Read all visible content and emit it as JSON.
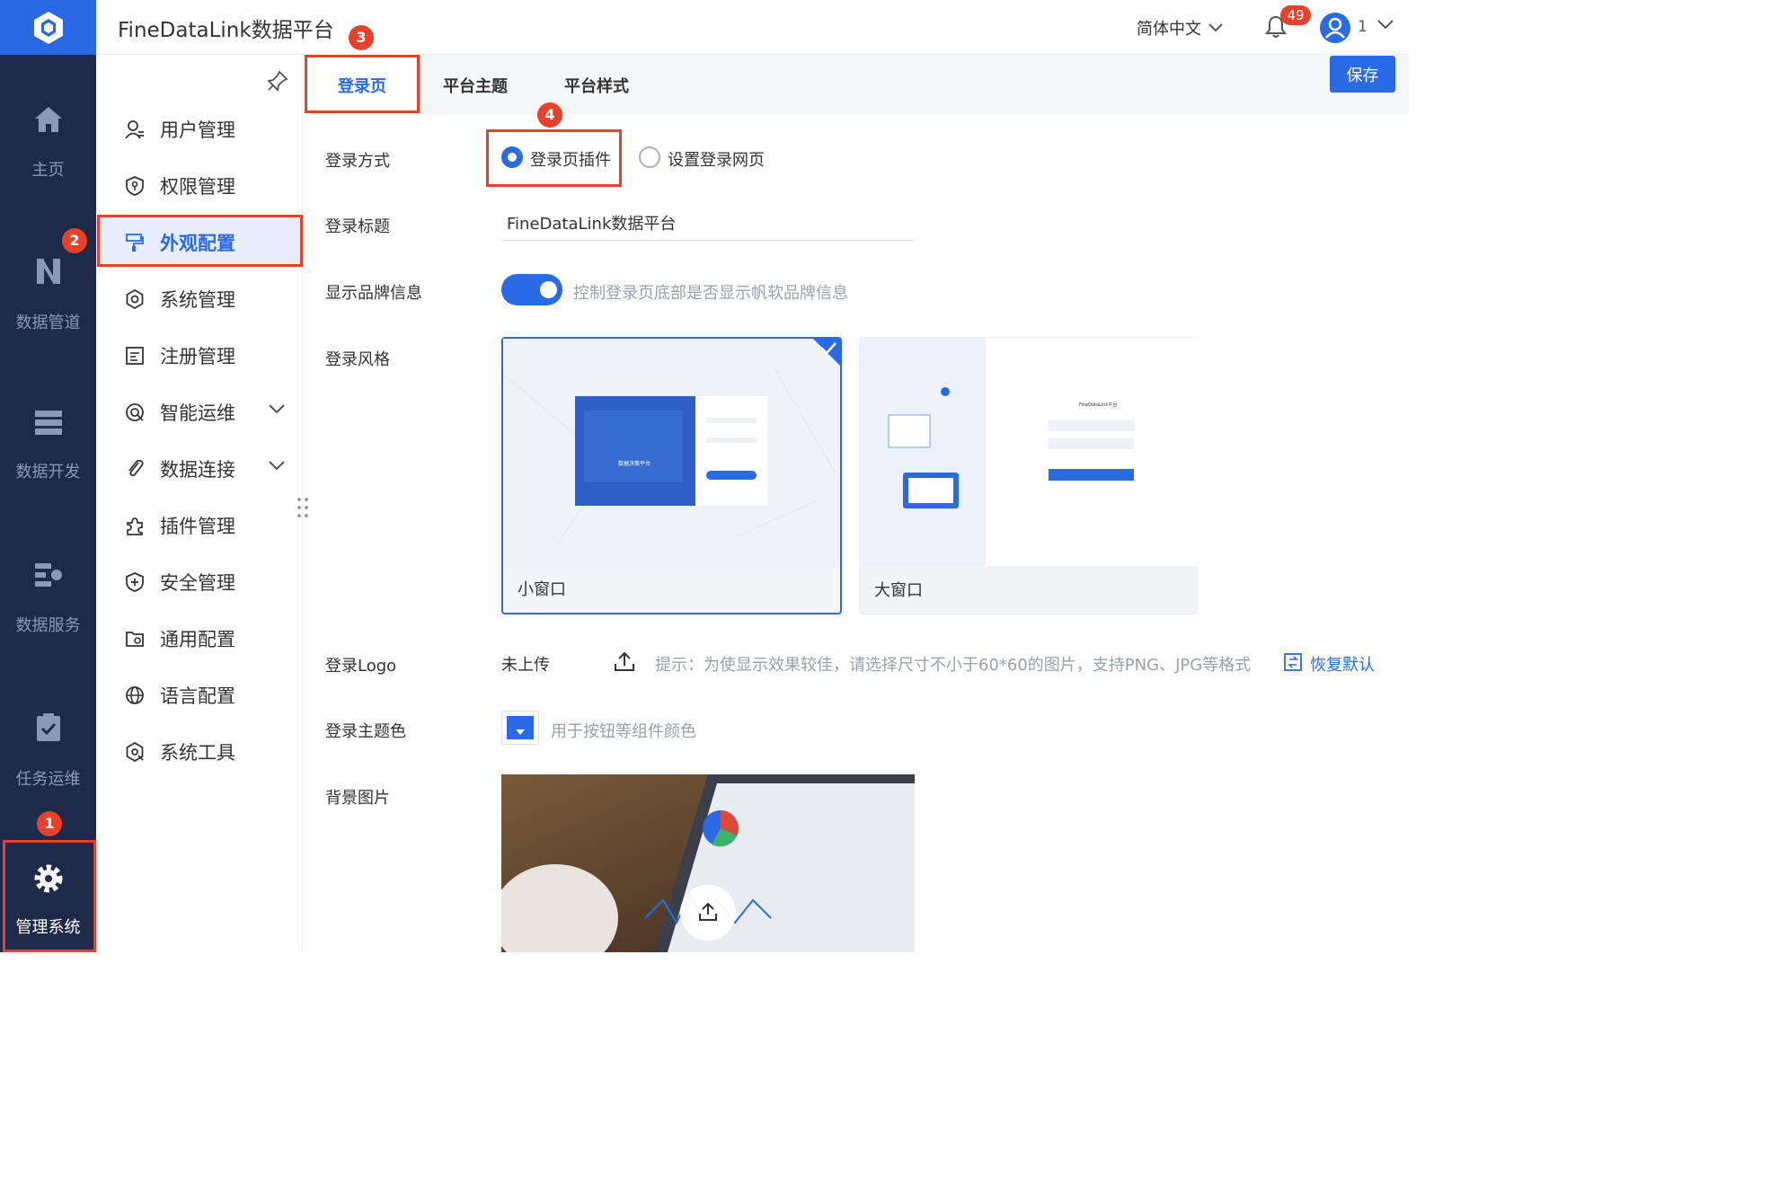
{
  "app": {
    "title": "FineDataLink数据平台"
  },
  "topbar": {
    "language": "简体中文",
    "notification_count": "49",
    "user_name": "1"
  },
  "nav": [
    {
      "label": "主页",
      "icon": "home-icon"
    },
    {
      "label": "数据管道",
      "icon": "pipeline-icon"
    },
    {
      "label": "数据开发",
      "icon": "dev-icon"
    },
    {
      "label": "数据服务",
      "icon": "service-icon"
    },
    {
      "label": "任务运维",
      "icon": "task-icon"
    },
    {
      "label": "管理系统",
      "icon": "gear-icon"
    }
  ],
  "menu": [
    {
      "label": "用户管理",
      "icon": "user-icon"
    },
    {
      "label": "权限管理",
      "icon": "permission-icon"
    },
    {
      "label": "外观配置",
      "icon": "paint-icon",
      "active": true
    },
    {
      "label": "系统管理",
      "icon": "settings-icon"
    },
    {
      "label": "注册管理",
      "icon": "register-icon"
    },
    {
      "label": "智能运维",
      "icon": "ops-icon",
      "expandable": true
    },
    {
      "label": "数据连接",
      "icon": "link-icon",
      "expandable": true
    },
    {
      "label": "插件管理",
      "icon": "plugin-icon"
    },
    {
      "label": "安全管理",
      "icon": "shield-icon"
    },
    {
      "label": "通用配置",
      "icon": "folder-icon"
    },
    {
      "label": "语言配置",
      "icon": "globe-icon"
    },
    {
      "label": "系统工具",
      "icon": "tool-icon"
    }
  ],
  "tabs": [
    "登录页",
    "平台主题",
    "平台样式"
  ],
  "save_label": "保存",
  "form": {
    "login_method_label": "登录方式",
    "login_method_options": [
      "登录页插件",
      "设置登录网页"
    ],
    "login_title_label": "登录标题",
    "login_title_value": "FineDataLink数据平台",
    "brand_label": "显示品牌信息",
    "brand_hint": "控制登录页底部是否显示帆软品牌信息",
    "style_label": "登录风格",
    "style_options": [
      "小窗口",
      "大窗口"
    ],
    "logo_label": "登录Logo",
    "logo_status": "未上传",
    "logo_hint": "提示：为使显示效果较佳，请选择尺寸不小于60*60的图片，支持PNG、JPG等格式",
    "restore_label": "恢复默认",
    "theme_color_label": "登录主题色",
    "theme_color_hint": "用于按钮等组件颜色",
    "bg_label": "背景图片"
  },
  "preview": {
    "small_caption": "数据决策平台",
    "large_brand": "FineDataLink平台"
  },
  "annotations": [
    "1",
    "2",
    "3",
    "4"
  ],
  "colors": {
    "accent": "#2a6ae5",
    "nav_bg": "#1e2a4a",
    "annotation": "#e8412b",
    "theme_color": "#2a6ae5"
  }
}
